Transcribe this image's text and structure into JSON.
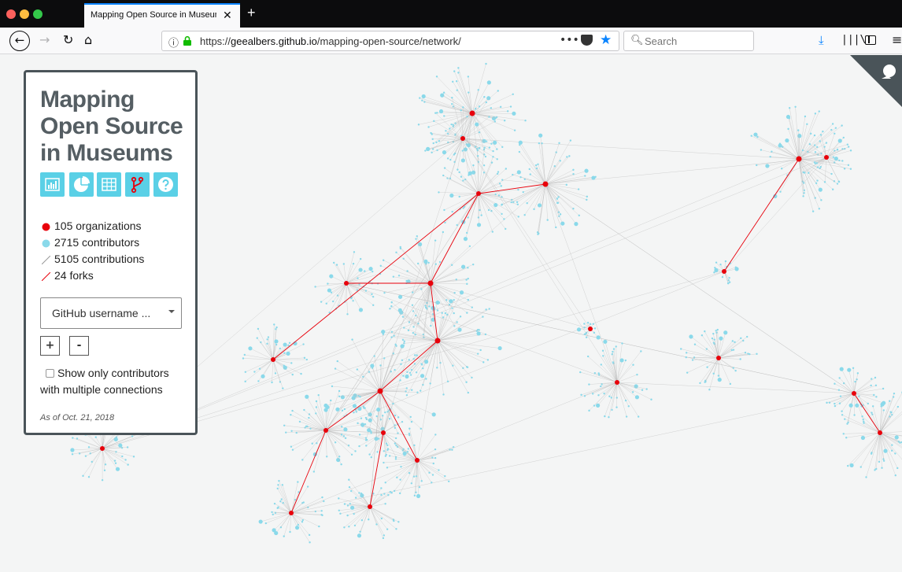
{
  "browser": {
    "tab_title": "Mapping Open Source in Museums",
    "tab_close": "✕",
    "new_tab": "+",
    "url_prefix": "https://",
    "url_domain": "geealbers.github.io",
    "url_path": "/mapping-open-source/network/",
    "url_more": "•••",
    "search_placeholder": "Search"
  },
  "panel": {
    "title": "Mapping Open Source in Museums",
    "view_buttons": [
      "bar-chart-icon",
      "pie-chart-icon",
      "table-icon",
      "fork-icon",
      "help-icon"
    ],
    "legend": {
      "organizations": "105 organizations",
      "contributors": "2715 contributors",
      "contributions": "5105 contributions",
      "forks": "24 forks"
    },
    "username_select": "GitHub username ...",
    "zoom_in": "+",
    "zoom_out": "-",
    "multi_label": "Show only contributors with multiple connections",
    "multi_checked": false,
    "as_of": "As of Oct. 21, 2018"
  },
  "colors": {
    "organization": "#e8000b",
    "contributor": "#8ad9ea",
    "contribution_line": "#b9b9b9",
    "fork_line": "#e8000b",
    "button": "#5ad0e6",
    "panel_border": "#4a5459",
    "accent": "#0a84ff"
  }
}
